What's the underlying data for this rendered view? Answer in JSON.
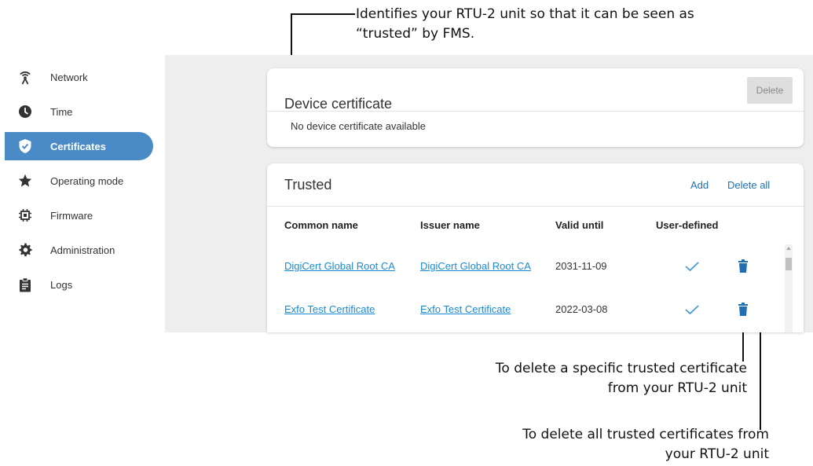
{
  "callouts": {
    "top": [
      "Identifies your RTU-2 unit so that it can be seen as",
      "“trusted” by FMS."
    ],
    "delete_row": [
      "To delete a specific trusted certificate",
      "from your RTU-2 unit"
    ],
    "delete_all": [
      "To delete all trusted certificates from",
      "your RTU-2 unit"
    ]
  },
  "sidebar": {
    "items": [
      {
        "label": "Network",
        "icon": "antenna-icon",
        "active": false
      },
      {
        "label": "Time",
        "icon": "clock-icon",
        "active": false
      },
      {
        "label": "Certificates",
        "icon": "shield-check-icon",
        "active": true
      },
      {
        "label": "Operating mode",
        "icon": "star-icon",
        "active": false
      },
      {
        "label": "Firmware",
        "icon": "chip-icon",
        "active": false
      },
      {
        "label": "Administration",
        "icon": "gear-icon",
        "active": false
      },
      {
        "label": "Logs",
        "icon": "clipboard-icon",
        "active": false
      }
    ]
  },
  "device_card": {
    "title": "Device certificate",
    "delete_label": "Delete",
    "empty_message": "No device certificate available"
  },
  "trusted_card": {
    "title": "Trusted",
    "add_label": "Add",
    "delete_all_label": "Delete all",
    "columns": [
      "Common name",
      "Issuer name",
      "Valid until",
      "User-defined"
    ],
    "rows": [
      {
        "common_name": "DigiCert Global Root CA",
        "issuer_name": "DigiCert Global Root CA",
        "valid_until": "2031-11-09",
        "user_defined": true
      },
      {
        "common_name": "Exfo Test Certificate",
        "issuer_name": "Exfo Test Certificate",
        "valid_until": "2022-03-08",
        "user_defined": true
      }
    ]
  },
  "colors": {
    "accent": "#4a8bc7",
    "link": "#1a8ad0",
    "trash": "#1f6fb2",
    "check": "#4a9ad8",
    "panel_bg": "#eeeeee"
  }
}
